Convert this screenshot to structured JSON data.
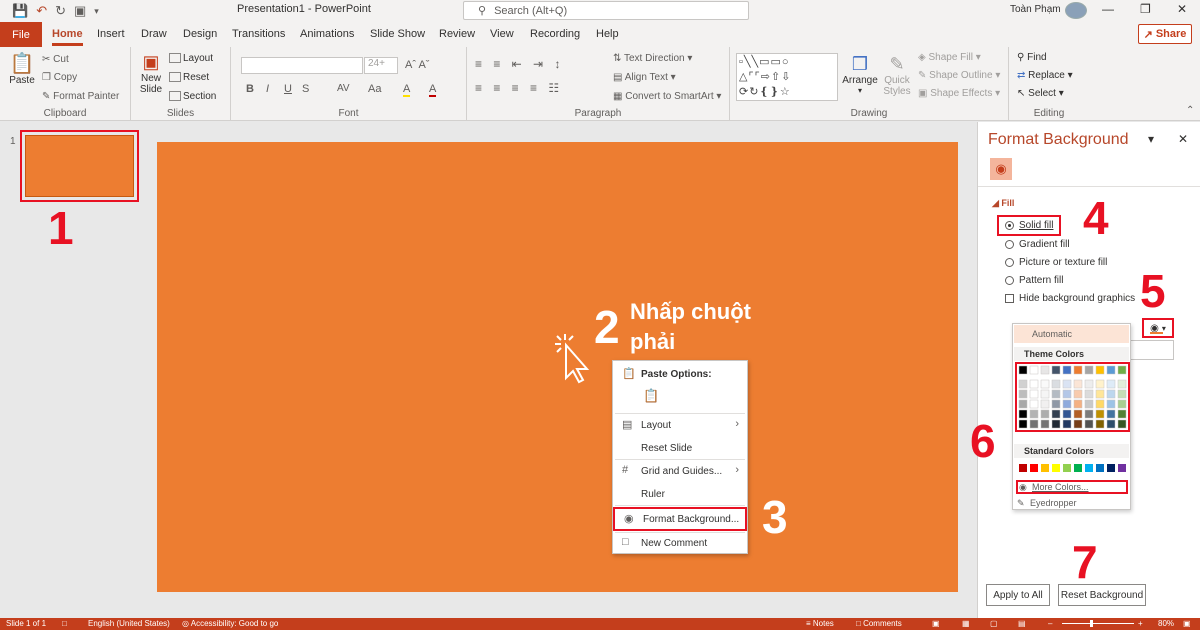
{
  "titlebar": {
    "document_title": "Presentation1  -  PowerPoint",
    "search_placeholder": "Search (Alt+Q)",
    "user_name": "Toàn Phạm"
  },
  "tabs": {
    "file": "File",
    "items": [
      "Home",
      "Insert",
      "Draw",
      "Design",
      "Transitions",
      "Animations",
      "Slide Show",
      "Review",
      "View",
      "Recording",
      "Help"
    ],
    "active": "Home",
    "share": "Share"
  },
  "ribbon": {
    "clipboard": {
      "label": "Clipboard",
      "paste": "Paste",
      "cut": "Cut",
      "copy": "Copy",
      "format_painter": "Format Painter"
    },
    "slides": {
      "label": "Slides",
      "new_slide_1": "New",
      "new_slide_2": "Slide",
      "layout": "Layout",
      "reset": "Reset",
      "section": "Section"
    },
    "font": {
      "label": "Font",
      "size": "24+",
      "bold": "B",
      "italic": "I",
      "underline": "U",
      "strike": "S",
      "spacing": "AV",
      "case": "Aa",
      "highlight": "A",
      "color": "A"
    },
    "paragraph": {
      "label": "Paragraph",
      "text_direction": "Text Direction",
      "align_text": "Align Text",
      "smartart": "Convert to SmartArt"
    },
    "drawing": {
      "label": "Drawing",
      "arrange": "Arrange",
      "quick_styles_1": "Quick",
      "quick_styles_2": "Styles",
      "shape_fill": "Shape Fill",
      "shape_outline": "Shape Outline",
      "shape_effects": "Shape Effects"
    },
    "editing": {
      "label": "Editing",
      "find": "Find",
      "replace": "Replace",
      "select": "Select"
    }
  },
  "thumbnail": {
    "number": "1"
  },
  "annotations": {
    "n1": "1",
    "n2": "2",
    "right_click_line1": "Nhấp chuột",
    "right_click_line2": "phải",
    "n3": "3",
    "n4": "4",
    "n5": "5",
    "n6": "6",
    "n7": "7"
  },
  "context_menu": {
    "paste_options": "Paste Options:",
    "layout": "Layout",
    "reset_slide": "Reset Slide",
    "grid_guides": "Grid and Guides...",
    "ruler": "Ruler",
    "format_background": "Format Background...",
    "new_comment": "New Comment"
  },
  "format_background": {
    "title": "Format Background",
    "section_fill": "Fill",
    "solid_fill": "Solid fill",
    "gradient_fill": "Gradient fill",
    "picture_fill": "Picture or texture fill",
    "pattern_fill": "Pattern fill",
    "hide_graphics": "Hide background graphics",
    "selected_fill": "Solid fill",
    "apply_all": "Apply to All",
    "reset_background": "Reset Background"
  },
  "color_dropdown": {
    "automatic": "Automatic",
    "theme_colors": "Theme Colors",
    "standard_colors": "Standard Colors",
    "more_colors": "More Colors...",
    "eyedropper": "Eyedropper",
    "theme_top": [
      "#000000",
      "#ffffff",
      "#e7e6e6",
      "#44546a",
      "#4472c4",
      "#ed7d31",
      "#a5a5a5",
      "#ffc000",
      "#5b9bd5",
      "#70ad47"
    ],
    "standard": [
      "#c00000",
      "#ff0000",
      "#ffc000",
      "#ffff00",
      "#92d050",
      "#00b050",
      "#00b0f0",
      "#0070c0",
      "#002060",
      "#7030a0"
    ]
  },
  "statusbar": {
    "slide_info": "Slide 1 of 1",
    "language": "English (United States)",
    "accessibility": "Accessibility: Good to go",
    "notes": "Notes",
    "comments": "Comments",
    "zoom": "80%"
  },
  "colors": {
    "slide_background": "#ed7d31",
    "accent": "#c43e1c",
    "annotation": "#e81123"
  }
}
